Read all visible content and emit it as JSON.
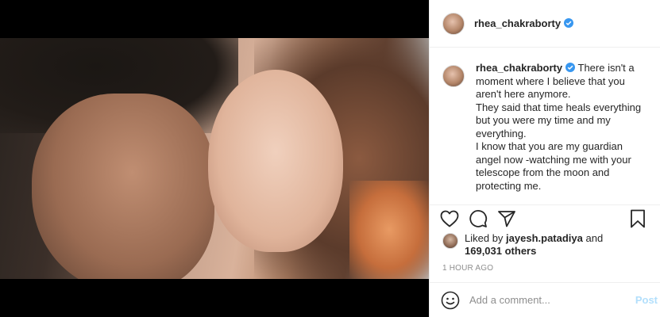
{
  "post": {
    "username": "rhea_chakraborty",
    "photo_alt": "photo"
  },
  "caption": {
    "username": "rhea_chakraborty",
    "text": " There isn't a moment where I believe that you aren't here anymore.\nThey said that time heals everything but you were my time and my everything.\nI know that you are my guardian angel now -watching me with your telescope from the moon and protecting me."
  },
  "likes": {
    "prefix": "Liked by ",
    "user": "jayesh.patadiya",
    "and": " and",
    "count": "169,031 others"
  },
  "timestamp": "1 HOUR AGO",
  "comment": {
    "placeholder": "Add a comment...",
    "post_label": "Post"
  },
  "icons": {
    "verified": "verified-badge-icon",
    "like": "heart-icon",
    "comment": "comment-bubble-icon",
    "share": "paper-plane-icon",
    "save": "bookmark-icon",
    "emoji": "smiley-icon"
  },
  "colors": {
    "verified_blue": "#3897f0",
    "post_button": "#b2dffc",
    "muted_text": "#8e8e8e"
  }
}
